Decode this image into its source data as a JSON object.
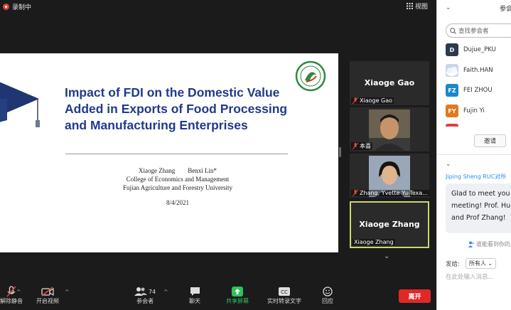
{
  "topbar": {
    "recording_label": "录制中",
    "view_label": "视图"
  },
  "slide": {
    "title": "Impact of FDI on the Domestic Value Added in Exports of Food Processing and Manufacturing Enterprises",
    "author1": "Xiaoge Zhang",
    "author2": "Benxi Lin*",
    "affiliation1": "College of Economics and Management",
    "affiliation2": "Fujian Agriculture and Forestry University",
    "date": "8/4/2021"
  },
  "video_tiles": [
    {
      "big_name": "Xiaoge Gao",
      "label": "Xiaoge Gao"
    },
    {
      "label": "本喜"
    },
    {
      "label": "Zhang, Yvette Yu-Texa..."
    },
    {
      "big_name": "Xiaoge Zhang",
      "label": "Xiaoge Zhang"
    }
  ],
  "toolbar": {
    "mute_label": "解除静音",
    "video_label": "开启视频",
    "participants_label": "参会者",
    "participants_count": "74",
    "chat_label": "聊天",
    "share_label": "共享屏幕",
    "transcript_label": "实时转录文字",
    "reactions_label": "回应",
    "leave_label": "离开"
  },
  "panel": {
    "title": "参会",
    "search_placeholder": "查找参会者",
    "participants": [
      {
        "initials": "D",
        "name": "Dujue_PKU",
        "color": "#2d3a4a"
      },
      {
        "initials": "",
        "name": "Faith.HAN",
        "color": "#c9d6e8"
      },
      {
        "initials": "FZ",
        "name": "FEI ZHOU",
        "color": "#1d87c9"
      },
      {
        "initials": "FY",
        "name": "Fujin Yi",
        "color": "#e07a1f"
      },
      {
        "initials": "",
        "name": "",
        "color": "#d9433b"
      }
    ],
    "invite_label": "邀请",
    "chat_sender": "Jiping Sheng RUC对所",
    "chat_message": "Glad to meet you meeting! Prof. Hu, and Prof Zhang!",
    "who_can_see": "谁能看到你的",
    "send_to_label": "发给:",
    "send_to_value": "所有人",
    "input_placeholder": "在此处输入消息..."
  },
  "colors": {
    "title_blue": "#1f3b8a",
    "leave_red": "#e02828",
    "share_green": "#2ec25b",
    "active_tile_border": "#cbd86a"
  }
}
